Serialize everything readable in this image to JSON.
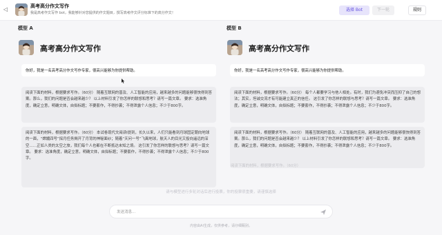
{
  "header": {
    "title": "高考高分作文写作",
    "description": "我是高考作文写作 bot，我能够针对您提供的作文题目，撰写高考作文评分标准下的高分作文！",
    "select_bot_label": "选择 Bot",
    "next_round_label": "下一轮",
    "rules_label": "规则"
  },
  "panels": [
    {
      "label": "模型 A",
      "bot_name": "高考高分作文写作",
      "greeting": "你好，我是一名高考高分作文写作专家，很高兴能够为你提供帮助。",
      "message1": "阅读下面的材料，根据要求写作。（60分） 随着互联网的普及、人工智能的应用，越来越多的问题能够很快得到答案。那么，我们的问题是否会越来越少？ 以上材料引发了你怎样的联想和思考？请写一篇文章。 要求：选准角度，确定立意，明确文体，自拟标题；不要套作，不得抄袭；不得泄露个人信息；不少于800字。",
      "message2": "阅读下面的材料，根据要求写作。（60分） 本试卷现代文阅读Ⅰ提到，长久以来，人们只能看到月球固定朝向地球的一面，“嫦娥四号”探月任务揭开了月背的神秘面纱；随着“天问一号”飞离地球，航天人的目光又投向遥远的深空……正如人类的太空之旅，我们每个人也都在不断抵达未知之境。 这引发了你怎样的联想与思考？请写一篇文章。 要求：选准角度，确定立意，明确文体，自拟标题；不要套作，不得抄袭；不得泄露个人信息；不少于800字。"
    },
    {
      "label": "模型 B",
      "bot_name": "高考高分作文写作",
      "greeting": "你好，我是一名高考高分作文写作专家，很高兴能够为你提供帮助。",
      "message1": "阅读下面的材料，根据要求写作。（60分） 每个人都要学习与他人相处。有时，我们为避免冲突而压抑了自己的想法；其实，坦诚交流才有可能建立真正的信任。 这引发了你怎样的联想与思考？请写一篇文章。 要求：选准角度，确定立意，明确文体，自拟标题；不要套作，不得抄袭；不得泄露个人信息；不少于800字。",
      "message2": "阅读下面的材料，根据要求写作。（60分） 随着互联网的普及、人工智能的应用，越来越多的问题能够很快得到答案。那么，我们的问题是否会越来越少？ 以上材料引发了你怎样的联想和思考？请写一篇文章。 要求：选准角度，确定立意，明确文体，自拟标题；不要套作，不得抄袭；不得泄露个人信息；不少于800字。",
      "message3_faded": "阅读下面的材料，根据要求写作。（60分）"
    }
  ],
  "status_text": "请与模型进行多轮对话后进行投票，你的投票很重要，请谨慎选择",
  "input": {
    "placeholder": "发送消息..."
  },
  "footer": "内容由AI生成，仅供参考，请仔细甄别。",
  "colors": {
    "accent": "#6452e0",
    "accent_bg": "#e7e4fb"
  },
  "icons": [
    "collapse-icon",
    "send-icon"
  ]
}
